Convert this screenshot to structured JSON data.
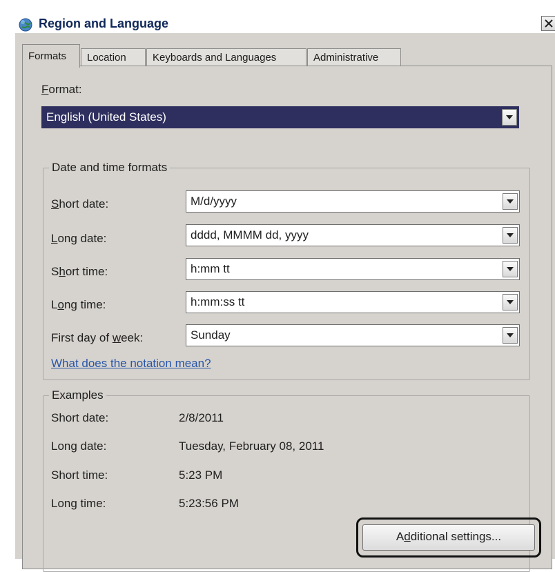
{
  "window": {
    "title": "Region and Language",
    "close_glyph": "✕",
    "icon": "globe-icon"
  },
  "tabs": [
    {
      "label": "Formats",
      "active": true
    },
    {
      "label": "Location",
      "active": false
    },
    {
      "label": "Keyboards and Languages",
      "active": false
    },
    {
      "label": "Administrative",
      "active": false
    }
  ],
  "format": {
    "label_accel": "F",
    "label_rest": "ormat:",
    "value": "English (United States)"
  },
  "datetime": {
    "group_title": "Date and time formats",
    "short_date": {
      "accel": "S",
      "rest": "hort date:",
      "value": "M/d/yyyy"
    },
    "long_date": {
      "accel": "L",
      "rest": "ong date:",
      "value": "dddd, MMMM dd, yyyy"
    },
    "short_time": {
      "pre": "S",
      "accel": "h",
      "rest": "ort time:",
      "value": "h:mm tt"
    },
    "long_time": {
      "pre": "L",
      "accel": "o",
      "rest": "ng time:",
      "value": "h:mm:ss tt"
    },
    "first_day": {
      "pre": "First day of ",
      "accel": "w",
      "rest": "eek:",
      "value": "Sunday"
    },
    "notation_link": "What does the notation mean?"
  },
  "examples": {
    "group_title": "Examples",
    "rows": [
      {
        "label": "Short date:",
        "value": "2/8/2011"
      },
      {
        "label": "Long date:",
        "value": "Tuesday, February 08, 2011"
      },
      {
        "label": "Short time:",
        "value": "5:23 PM"
      },
      {
        "label": "Long time:",
        "value": "5:23:56 PM"
      }
    ]
  },
  "additional_button": {
    "pre": "A",
    "accel": "d",
    "rest": "ditional settings..."
  },
  "colors": {
    "title_text": "#10285a",
    "dialog_bg": "#d6d3ce",
    "selected_bg": "#2e2f5e",
    "link": "#2855a8"
  }
}
